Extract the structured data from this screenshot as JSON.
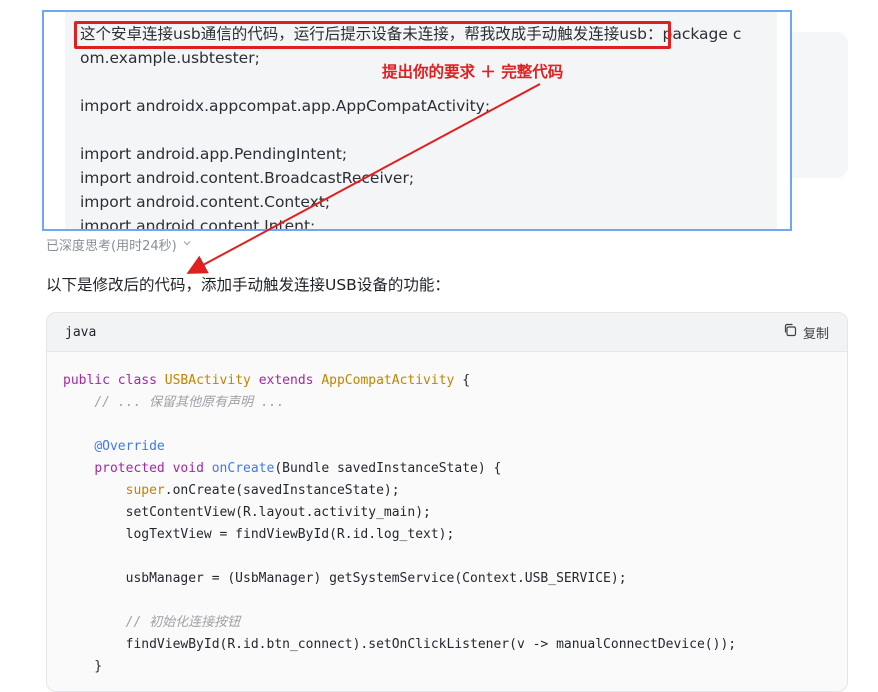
{
  "prompt_screenshot": {
    "line1_highlight": "这个安卓连接usb通信的代码，运行后提示设备未连接，帮我改成手动触发连接usb：",
    "line1_rest": "package c",
    "line2": "om.example.usbtester;",
    "line3": "",
    "line4": "import androidx.appcompat.app.AppCompatActivity;",
    "line5": "",
    "line6": "import android.app.PendingIntent;",
    "line7": "import android.content.BroadcastReceiver;",
    "line8": "import android.content.Context;",
    "line9": "import android.content.Intent;"
  },
  "annotation": {
    "text": "提出你的要求 ＋ 完整代码",
    "color": "#e02020"
  },
  "thinking": {
    "label": "已深度思考(用时24秒)",
    "icon": "chevron-down-icon"
  },
  "response": {
    "intro": "以下是修改后的代码，添加手动触发连接USB设备的功能："
  },
  "code_block": {
    "language": "java",
    "copy_label": "复制",
    "copy_icon": "copy-icon",
    "lines": [
      [
        [
          "kw",
          "public "
        ],
        [
          "kw",
          "class "
        ],
        [
          "cls",
          "USBActivity "
        ],
        [
          "kw",
          "extends "
        ],
        [
          "cls",
          "AppCompatActivity "
        ],
        [
          "",
          "{"
        ]
      ],
      [
        [
          "",
          "    "
        ],
        [
          "cmt",
          "// ... 保留其他原有声明 ..."
        ]
      ],
      [
        [
          "",
          ""
        ]
      ],
      [
        [
          "",
          "    "
        ],
        [
          "ann",
          "@Override"
        ]
      ],
      [
        [
          "",
          "    "
        ],
        [
          "kw",
          "protected "
        ],
        [
          "kw",
          "void "
        ],
        [
          "fn",
          "onCreate"
        ],
        [
          "",
          "(Bundle savedInstanceState) {"
        ]
      ],
      [
        [
          "",
          "        "
        ],
        [
          "sup",
          "super"
        ],
        [
          "",
          ".onCreate(savedInstanceState);"
        ]
      ],
      [
        [
          "",
          "        setContentView(R.layout.activity_main);"
        ]
      ],
      [
        [
          "",
          "        logTextView = findViewById(R.id.log_text);"
        ]
      ],
      [
        [
          "",
          ""
        ]
      ],
      [
        [
          "",
          "        usbManager = (UsbManager) getSystemService(Context.USB_SERVICE);"
        ]
      ],
      [
        [
          "",
          ""
        ]
      ],
      [
        [
          "",
          "        "
        ],
        [
          "cmt",
          "// 初始化连接按钮"
        ]
      ],
      [
        [
          "",
          "        findViewById(R.id.btn_connect).setOnClickListener(v -> manualConnectDevice());"
        ]
      ],
      [
        [
          "",
          "    }"
        ]
      ]
    ]
  }
}
